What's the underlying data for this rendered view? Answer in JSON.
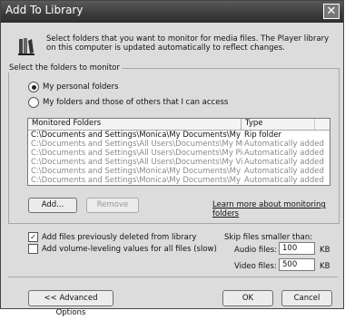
{
  "dialog": {
    "title": "Add To Library",
    "close_glyph": "✕"
  },
  "intro": {
    "icon": "library-icon",
    "text": "Select folders that you want to monitor for media files. The Player library on this computer is updated automatically to reflect changes."
  },
  "folders_group": {
    "label": "Select the folders to monitor",
    "option_personal": "My personal folders",
    "option_all": "My folders and those of others that I can access",
    "selected": "My personal folders"
  },
  "folder_list": {
    "headers": [
      "Monitored Folders",
      "Type"
    ],
    "rows": [
      {
        "folder": "C:\\Documents and Settings\\Monica\\My Documents\\My Music",
        "type": "Rip folder"
      },
      {
        "folder": "C:\\Documents and Settings\\All Users\\Documents\\My Music",
        "type": "Automatically added"
      },
      {
        "folder": "C:\\Documents and Settings\\All Users\\Documents\\My Pictures",
        "type": "Automatically added"
      },
      {
        "folder": "C:\\Documents and Settings\\All Users\\Documents\\My Videos",
        "type": "Automatically added"
      },
      {
        "folder": "C:\\Documents and Settings\\Monica\\My Documents\\My Pictu...",
        "type": "Automatically added"
      },
      {
        "folder": "C:\\Documents and Settings\\Monica\\My Documents\\My Videos",
        "type": "Automatically added"
      }
    ]
  },
  "buttons": {
    "add": "Add...",
    "remove": "Remove",
    "learn_more": "Learn more about monitoring folders",
    "advanced": "<< Advanced Options",
    "ok": "OK",
    "cancel": "Cancel"
  },
  "options": {
    "add_deleted": {
      "label": "Add files previously deleted from library",
      "checked": true
    },
    "volume_leveling": {
      "label": "Add volume-leveling values for all files (slow)",
      "checked": false
    }
  },
  "skip": {
    "heading": "Skip files smaller than:",
    "audio_label": "Audio files:",
    "audio_value": "100",
    "video_label": "Video files:",
    "video_value": "500",
    "unit": "KB"
  }
}
